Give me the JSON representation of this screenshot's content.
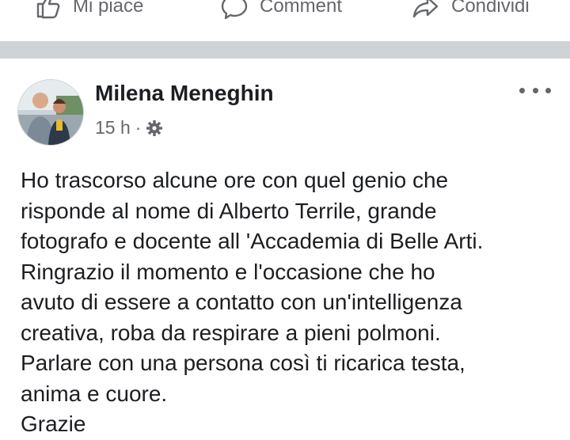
{
  "actions": {
    "like": {
      "label": "Mi piace",
      "icon": "thumbs-up-icon"
    },
    "comment": {
      "label": "Comment",
      "icon": "comment-icon"
    },
    "share": {
      "label": "Condividi",
      "icon": "share-icon"
    }
  },
  "post": {
    "author": "Milena Meneghin",
    "time": "15 h",
    "separator": "·",
    "privacy_icon": "gear-icon",
    "more_icon": "more-options-icon",
    "text": "Ho trascorso alcune ore con quel genio che\nrisponde al nome di Alberto Terrile, grande\nfotografo e docente all 'Accademia di Belle Arti.\nRingrazio il momento e l'occasione che ho\navuto di essere a contatto con un'intelligenza\ncreativa, roba da respirare a pieni polmoni.\nParlare con una persona così ti ricarica testa,\nanima e cuore.\nGrazie"
  },
  "colors": {
    "text_primary": "#1c1e21",
    "text_secondary": "#65676b",
    "separator": "#cfd2d6"
  }
}
